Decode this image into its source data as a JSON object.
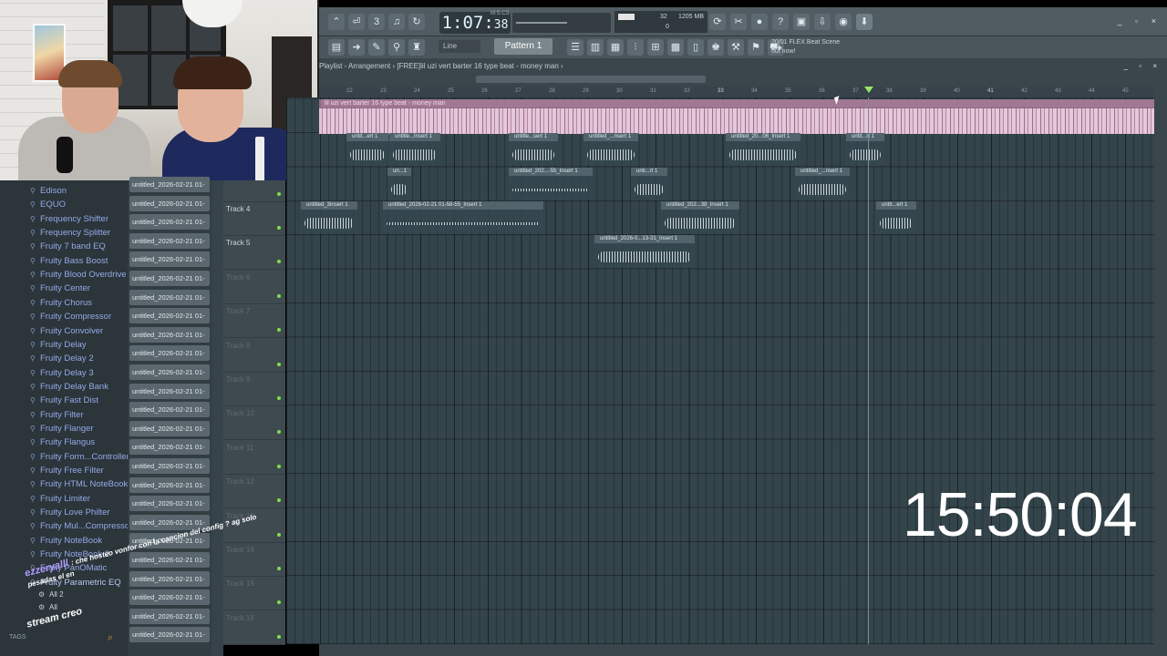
{
  "transport": {
    "time": "1:07",
    "time_small": "38",
    "time_unit": "M:S:CS",
    "pattern": "Pattern 1",
    "snap": "Line",
    "cpu_val": "32",
    "mem_val": "1205 MB",
    "voices": "0"
  },
  "hint": {
    "line1": "20/01  FLEX  Beat Scene",
    "line2": "out now!"
  },
  "window_controls": "_ ▫ ×",
  "playlist": {
    "title": "Playlist - Arrangement › [FREE]lil uzi vert  barter 16 type beat - money man ›",
    "ruler": [
      "22",
      "23",
      "24",
      "25",
      "26",
      "27",
      "28",
      "29",
      "30",
      "31",
      "32",
      "33",
      "34",
      "35",
      "36",
      "37",
      "38",
      "39",
      "40",
      "41",
      "42",
      "43",
      "44",
      "45"
    ],
    "lane1_label": "lil uzi vert  barter 16 type beat - money man",
    "clips": [
      {
        "label": "untit...ert 1"
      },
      {
        "label": "untitle...Insert 1"
      },
      {
        "label": "untitle...sert 1"
      },
      {
        "label": "untitled_...nsert 1"
      },
      {
        "label": "untitled_20...06_Insert 1"
      },
      {
        "label": "untit...rt 1"
      },
      {
        "label": "un...1"
      },
      {
        "label": "untitled_202...-55_Insert 1"
      },
      {
        "label": "unti...rt 1"
      },
      {
        "label": "untitled_...nsert 1"
      },
      {
        "label": "untitled_3insert 1"
      },
      {
        "label": "untitled_2026-02-21 01-58-55_Insert 1"
      },
      {
        "label": "untitled_202...38_Insert 1"
      },
      {
        "label": "untit...ert 1"
      },
      {
        "label": "untitled_2026-0...13-31_Insert 1"
      }
    ]
  },
  "tracks": [
    "Track 4",
    "Track 5",
    "Track 6",
    "Track 7",
    "Track 8",
    "Track 9",
    "Track 10",
    "Track 11",
    "Track 12",
    "Track 13",
    "Track 14",
    "Track 15",
    "Track 16"
  ],
  "plugins": [
    "Edison",
    "EQUO",
    "Frequency Shifter",
    "Frequency Splitter",
    "Fruity 7 band EQ",
    "Fruity Bass Boost",
    "Fruity Blood Overdrive",
    "Fruity Center",
    "Fruity Chorus",
    "Fruity Compressor",
    "Fruity Convolver",
    "Fruity Delay",
    "Fruity Delay 2",
    "Fruity Delay 3",
    "Fruity Delay Bank",
    "Fruity Fast Dist",
    "Fruity Filter",
    "Fruity Flanger",
    "Fruity Flangus",
    "Fruity Form...Controller",
    "Fruity Free Filter",
    "Fruity HTML NoteBook",
    "Fruity Limiter",
    "Fruity Love Philter",
    "Fruity Mul...Compressor",
    "Fruity NoteBook",
    "Fruity NoteBook 2",
    "Fruity PanOMatic",
    "Fruity Parametric EQ"
  ],
  "plugin_presets": [
    "All 2",
    "All"
  ],
  "recent_file": "untitled_2026-02-21 01-",
  "tags_label": "TAGS",
  "chat": {
    "user": "ezzeryalll",
    "msg": ": che hosteo vonfor con la cancion del config ? ag solo pesadas el en",
    "line2": "stream creo"
  },
  "timer": "15:50:04",
  "colors": {
    "accent": "#97e66b",
    "audio_clip": "#8d6a80",
    "plugin_text": "#96a9e8"
  }
}
